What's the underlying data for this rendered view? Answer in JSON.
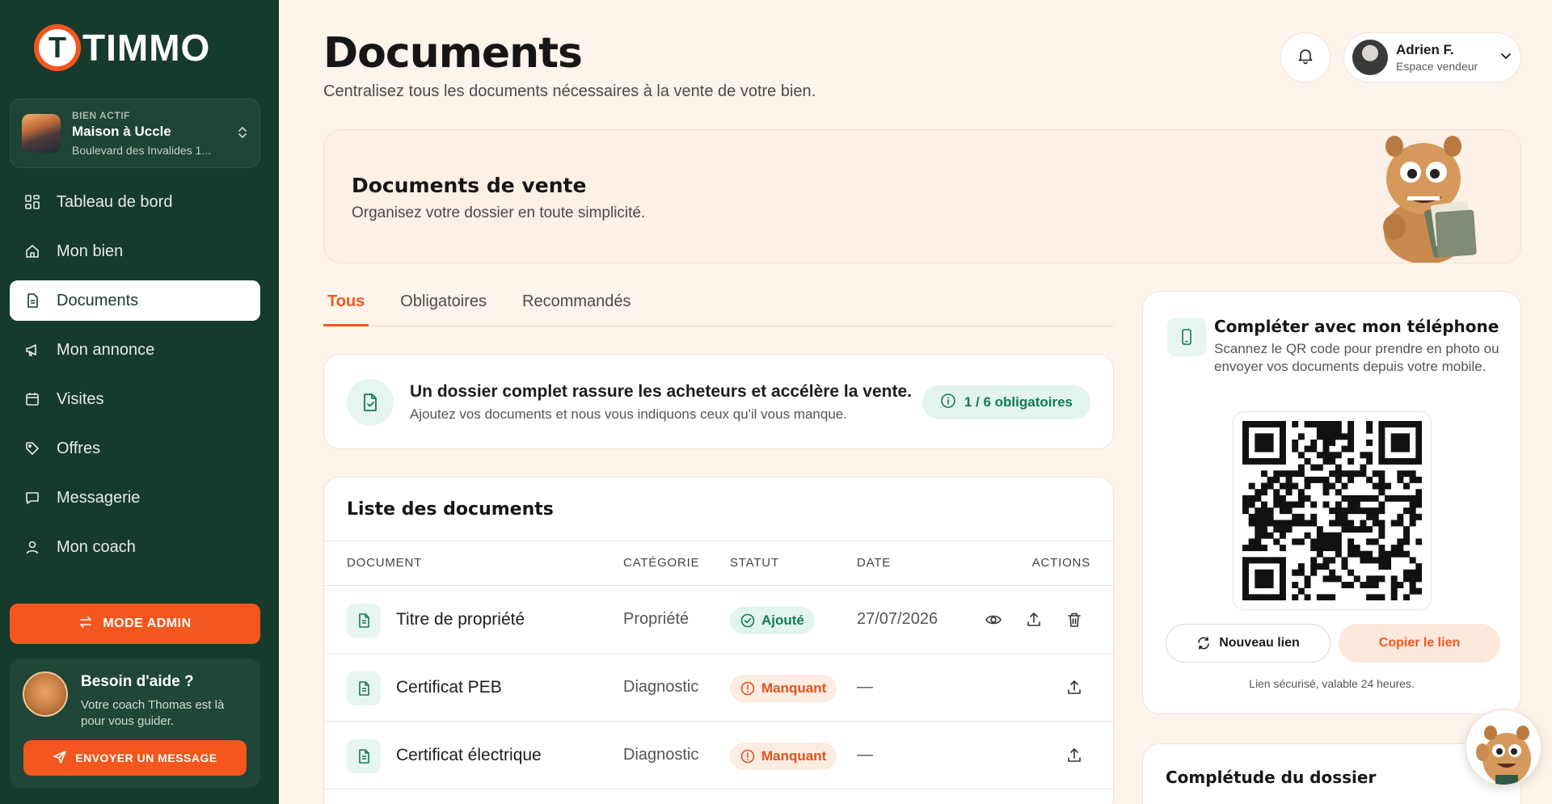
{
  "brand": {
    "name": "TIMMO",
    "mark_letter": "T",
    "accent": "#f4561e",
    "sidebar_bg": "#163a2c"
  },
  "property": {
    "tag": "BIEN ACTIF",
    "name": "Maison à Uccle",
    "address": "Boulevard des Invalides 1..."
  },
  "nav": [
    {
      "label": "Tableau de bord",
      "icon": "dashboard-icon",
      "active": false
    },
    {
      "label": "Mon bien",
      "icon": "home-icon",
      "active": false
    },
    {
      "label": "Documents",
      "icon": "document-icon",
      "active": true
    },
    {
      "label": "Mon annonce",
      "icon": "megaphone-icon",
      "active": false
    },
    {
      "label": "Visites",
      "icon": "calendar-icon",
      "active": false
    },
    {
      "label": "Offres",
      "icon": "tag-icon",
      "active": false
    },
    {
      "label": "Messagerie",
      "icon": "chat-icon",
      "active": false
    },
    {
      "label": "Mon coach",
      "icon": "user-icon",
      "active": false
    }
  ],
  "admin_button": "MODE ADMIN",
  "help": {
    "title": "Besoin d'aide ?",
    "text": "Votre coach Thomas est là pour vous guider.",
    "button": "ENVOYER UN MESSAGE"
  },
  "header": {
    "title": "Documents",
    "subtitle": "Centralisez tous les documents nécessaires à la vente de votre bien."
  },
  "user": {
    "name": "Adrien F.",
    "role": "Espace vendeur"
  },
  "banner": {
    "title": "Documents de vente",
    "subtitle": "Organisez votre dossier en toute simplicité."
  },
  "tabs": [
    {
      "label": "Tous",
      "active": true
    },
    {
      "label": "Obligatoires",
      "active": false
    },
    {
      "label": "Recommandés",
      "active": false
    }
  ],
  "info": {
    "title": "Un dossier complet rassure les acheteurs et accélère la vente.",
    "subtitle": "Ajoutez vos documents et nous vous indiquons ceux qu'il vous manque.",
    "badge": "1 / 6 obligatoires"
  },
  "documents": {
    "title": "Liste des documents",
    "columns": {
      "document": "DOCUMENT",
      "category": "CATÉGORIE",
      "status": "STATUT",
      "date": "DATE",
      "actions": "ACTIONS"
    },
    "rows": [
      {
        "name": "Titre de propriété",
        "category": "Propriété",
        "status": "Ajouté",
        "status_type": "ok",
        "date": "27/07/2026"
      },
      {
        "name": "Certificat PEB",
        "category": "Diagnostic",
        "status": "Manquant",
        "status_type": "missing",
        "date": "—"
      },
      {
        "name": "Certificat électrique",
        "category": "Diagnostic",
        "status": "Manquant",
        "status_type": "missing",
        "date": "—"
      }
    ]
  },
  "phone": {
    "title": "Compléter avec mon téléphone",
    "subtitle": "Scannez le QR code pour prendre en photo ou envoyer vos documents depuis votre mobile.",
    "new_link": "Nouveau lien",
    "copy_link": "Copier le lien",
    "note": "Lien sécurisé, valable 24 heures."
  },
  "completeness": {
    "title": "Complétude du dossier"
  }
}
